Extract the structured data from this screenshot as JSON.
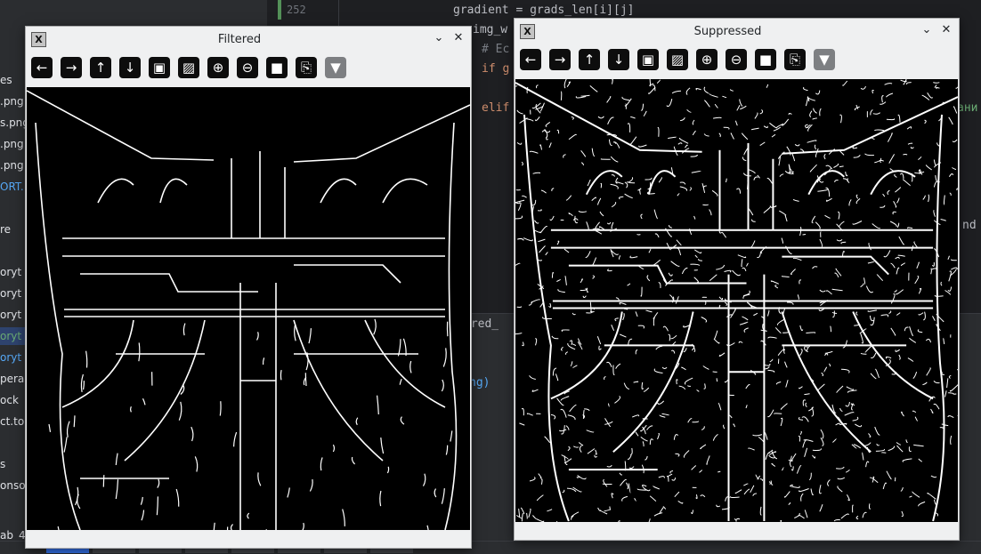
{
  "ide": {
    "line_number": "252",
    "code_lines": [
      {
        "text": "gradient = grads_len[i][j]"
      },
      {
        "text": "img_w"
      },
      {
        "text": "# Еc"
      },
      {
        "text": "if g"
      },
      {
        "text": "elif"
      },
      {
        "text": "ани"
      },
      {
        "text": "nd"
      },
      {
        "text": "ered_"
      },
      {
        "text": "ng)"
      }
    ],
    "project_items": [
      "es",
      ".png",
      "s.png",
      ".png",
      ".png",
      "ORT.",
      "re",
      "oryt",
      "oryt",
      "oryt",
      "oryt",
      "oryt",
      "pera",
      "ock",
      "ct.to",
      "s",
      "onso",
      "ab_4"
    ]
  },
  "windows": {
    "filtered": {
      "title": "Filtered",
      "icon": "x-app-icon"
    },
    "suppressed": {
      "title": "Suppressed",
      "icon": "x-app-icon"
    }
  },
  "toolbar_icons": [
    "back-icon",
    "forward-icon",
    "up-icon",
    "down-icon",
    "image-icon",
    "image-edit-icon",
    "zoom-in-icon",
    "zoom-out-icon",
    "save-icon",
    "clipboard-icon",
    "color-picker-icon"
  ],
  "toolbar_glyphs": [
    "←",
    "→",
    "↑",
    "↓",
    "▣",
    "▨",
    "⊕",
    "⊖",
    "■",
    "⎘",
    "▼"
  ],
  "colors": {
    "accent": "#3574f0",
    "image_bg": "#000000",
    "edge": "#ffffff"
  }
}
